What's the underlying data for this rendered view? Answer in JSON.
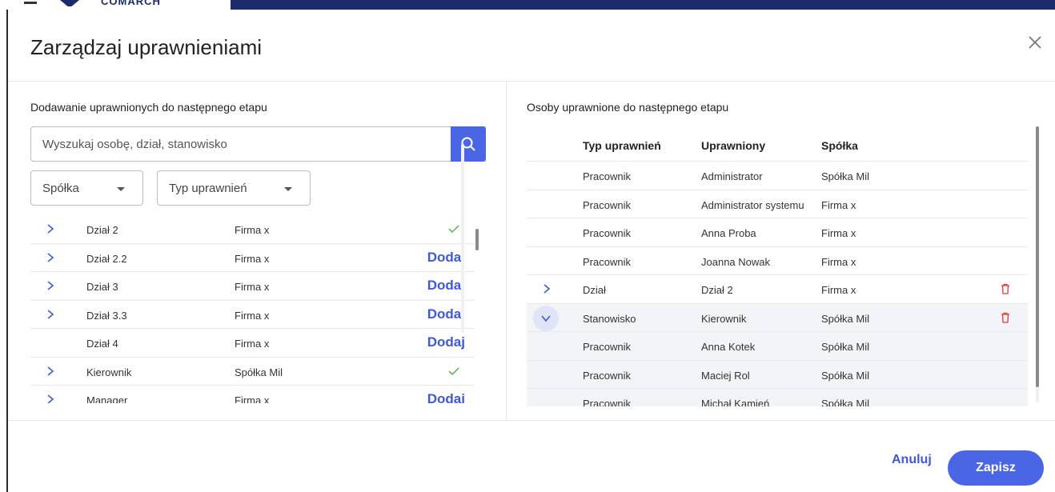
{
  "app": {
    "brand": "COMARCH"
  },
  "dialog": {
    "title": "Zarządzaj uprawnieniami",
    "close_icon": "close-icon"
  },
  "left": {
    "section_title": "Dodawanie uprawnionych do następnego etapu",
    "search": {
      "placeholder": "Wyszukaj osobę, dział, stanowisko",
      "value": ""
    },
    "filters": {
      "company_label": "Spółka",
      "type_label": "Typ uprawnień"
    },
    "rows": [
      {
        "name": "Dział 2",
        "company": "Firma x",
        "expandable": true,
        "added": true
      },
      {
        "name": "Dział 2.2",
        "company": "Firma x",
        "expandable": true,
        "added": false
      },
      {
        "name": "Dział 3",
        "company": "Firma x",
        "expandable": true,
        "added": false
      },
      {
        "name": "Dział 3.3",
        "company": "Firma x",
        "expandable": true,
        "added": false
      },
      {
        "name": "Dział 4",
        "company": "Firma x",
        "expandable": false,
        "added": false
      },
      {
        "name": "Kierownik",
        "company": "Spółka Mil",
        "expandable": true,
        "added": true
      },
      {
        "name": "Manager",
        "company": "Firma x",
        "expandable": true,
        "added": false
      }
    ],
    "add_label": "Dodaj"
  },
  "right": {
    "section_title": "Osoby uprawnione do następnego etapu",
    "columns": {
      "type": "Typ uprawnień",
      "person": "Uprawniony",
      "company": "Spółka"
    },
    "rows": [
      {
        "type": "Pracownik",
        "person": "Administrator",
        "company": "Spółka Mil"
      },
      {
        "type": "Pracownik",
        "person": "Administrator systemu",
        "company": "Firma x"
      },
      {
        "type": "Pracownik",
        "person": "Anna Proba",
        "company": "Firma x"
      },
      {
        "type": "Pracownik",
        "person": "Joanna Nowak",
        "company": "Firma x"
      },
      {
        "type": "Dział",
        "person": "Dział 2",
        "company": "Firma x"
      },
      {
        "type": "Stanowisko",
        "person": "Kierownik",
        "company": "Spółka Mil"
      },
      {
        "type": "Pracownik",
        "person": "Anna Kotek",
        "company": "Spółka Mil"
      },
      {
        "type": "Pracownik",
        "person": "Maciej Rol",
        "company": "Spółka Mil"
      },
      {
        "type": "Pracownik",
        "person": "Michał Kamień",
        "company": "Spółka Mil"
      }
    ]
  },
  "footer": {
    "cancel_label": "Anuluj",
    "save_label": "Zapisz"
  },
  "colors": {
    "accent": "#4a66e5",
    "link": "#3d59d9",
    "check": "#4caf50",
    "delete": "#e53935"
  }
}
